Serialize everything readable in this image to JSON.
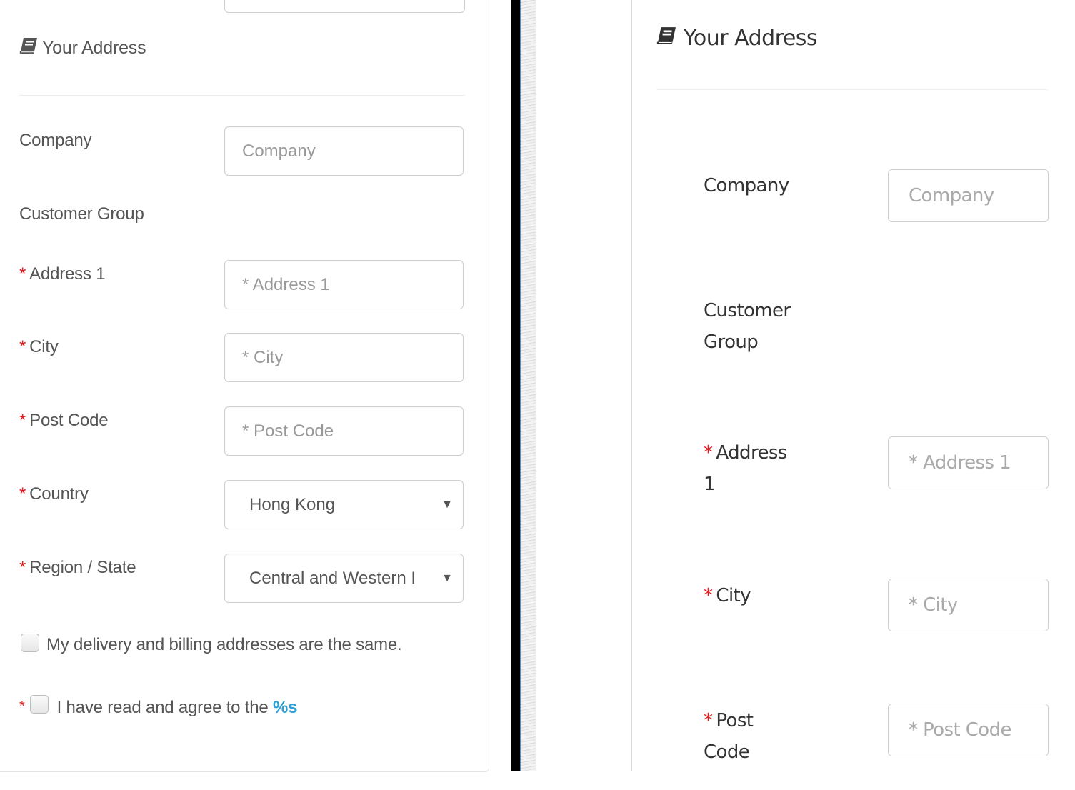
{
  "left": {
    "legend": "Your Address",
    "legend_icon": "book-icon",
    "fields": {
      "company": {
        "label": "Company",
        "placeholder": "Company",
        "required": false
      },
      "customer_group": {
        "label": "Customer Group"
      },
      "address1": {
        "label": "Address 1",
        "placeholder": "* Address 1",
        "required": true
      },
      "city": {
        "label": "City",
        "placeholder": "* City",
        "required": true
      },
      "postcode": {
        "label": "Post Code",
        "placeholder": "* Post Code",
        "required": true
      },
      "country": {
        "label": "Country",
        "value": "Hong Kong",
        "required": true
      },
      "region": {
        "label": "Region / State",
        "value": "Central and Western I",
        "required": true
      }
    },
    "same_address": {
      "label": "My delivery and billing addresses are the same.",
      "checked": false
    },
    "agree": {
      "label": "I have read and agree to the ",
      "link": "%s",
      "checked": false
    }
  },
  "right": {
    "legend": "Your Address",
    "legend_icon": "book-icon",
    "fields": {
      "company": {
        "label": "Company",
        "placeholder": "Company"
      },
      "customer_group": {
        "label": "Customer Group"
      },
      "address1": {
        "label": "Address 1",
        "placeholder": "* Address 1"
      },
      "city": {
        "label": "City",
        "placeholder": "* City"
      },
      "postcode": {
        "label": "Post Code",
        "placeholder": "* Post Code"
      }
    }
  },
  "required_mark": "*",
  "dropdown_arrow": "▼",
  "colors": {
    "required": "#e21b1b",
    "link": "#2a9fd6",
    "border": "#cfcfcf"
  }
}
